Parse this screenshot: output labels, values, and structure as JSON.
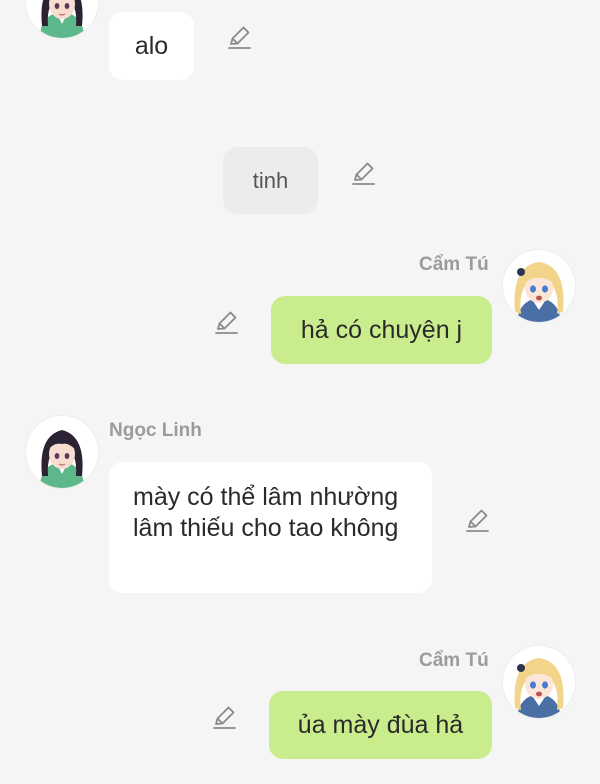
{
  "messages": [
    {
      "sender": "",
      "text": "alo",
      "type": "received"
    },
    {
      "text": "tinh",
      "type": "system"
    },
    {
      "sender": "Cẩm Tú",
      "text": "hả có chuyện j",
      "type": "sent"
    },
    {
      "sender": "Ngọc Linh",
      "text": "mày có thể lâm nhường lâm thiếu cho tao không",
      "type": "received"
    },
    {
      "sender": "Cẩm Tú",
      "text": "ủa mày đùa hả",
      "type": "sent"
    }
  ],
  "colors": {
    "background": "#f5f5f5",
    "received_bubble": "#ffffff",
    "sent_bubble": "#c9ec8c",
    "system_bubble": "#ececec",
    "sender_name": "#9b9b9b"
  },
  "icons": {
    "edit": "pencil-edit-icon",
    "avatar_left": "dark-haired-girl-avatar",
    "avatar_right": "blonde-girl-avatar"
  }
}
